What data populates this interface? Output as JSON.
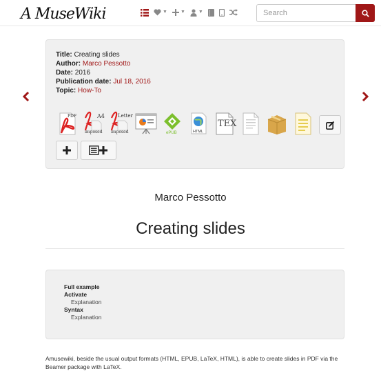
{
  "logo": {
    "text": "A MuseWiki"
  },
  "nav": {
    "icons": [
      {
        "name": "list-icon",
        "active": true,
        "caret": false
      },
      {
        "name": "heart-icon",
        "active": false,
        "caret": true
      },
      {
        "name": "plus-icon",
        "active": false,
        "caret": true
      },
      {
        "name": "user-icon",
        "active": false,
        "caret": true
      },
      {
        "name": "book-icon",
        "active": false,
        "caret": false
      },
      {
        "name": "mobile-icon",
        "active": false,
        "caret": false
      },
      {
        "name": "shuffle-icon",
        "active": false,
        "caret": false
      }
    ]
  },
  "search": {
    "placeholder": "Search",
    "value": ""
  },
  "metadata": {
    "title_label": "Title:",
    "title_value": "Creating slides",
    "author_label": "Author:",
    "author_value": "Marco Pessotto",
    "date_label": "Date:",
    "date_value": "2016",
    "pubdate_label": "Publication date:",
    "pubdate_value": "Jul 18, 2016",
    "topic_label": "Topic:",
    "topic_value": "How-To"
  },
  "formats": {
    "pdf_label": "PDF",
    "a4_label": "A4",
    "a4_sub": "imposed",
    "letter_label": "Letter",
    "letter_sub": "imposed",
    "epub_label": "ePUB",
    "html_label": "HTML",
    "tex_label": "TEX"
  },
  "page": {
    "author": "Marco Pessotto",
    "title": "Creating slides"
  },
  "toc": [
    {
      "label": "Full example",
      "level": 1
    },
    {
      "label": "Activate",
      "level": 1
    },
    {
      "label": "Explanation",
      "level": 2
    },
    {
      "label": "Syntax",
      "level": 1
    },
    {
      "label": "Explanation",
      "level": 2
    }
  ],
  "body": {
    "paragraph": "Amusewiki, beside the usual output formats (HTML, EPUB, LaTeX, HTML), is able to create slides in PDF via the Beamer package with LaTeX."
  },
  "colors": {
    "accent": "#a01717",
    "well": "#f0f0f0"
  }
}
